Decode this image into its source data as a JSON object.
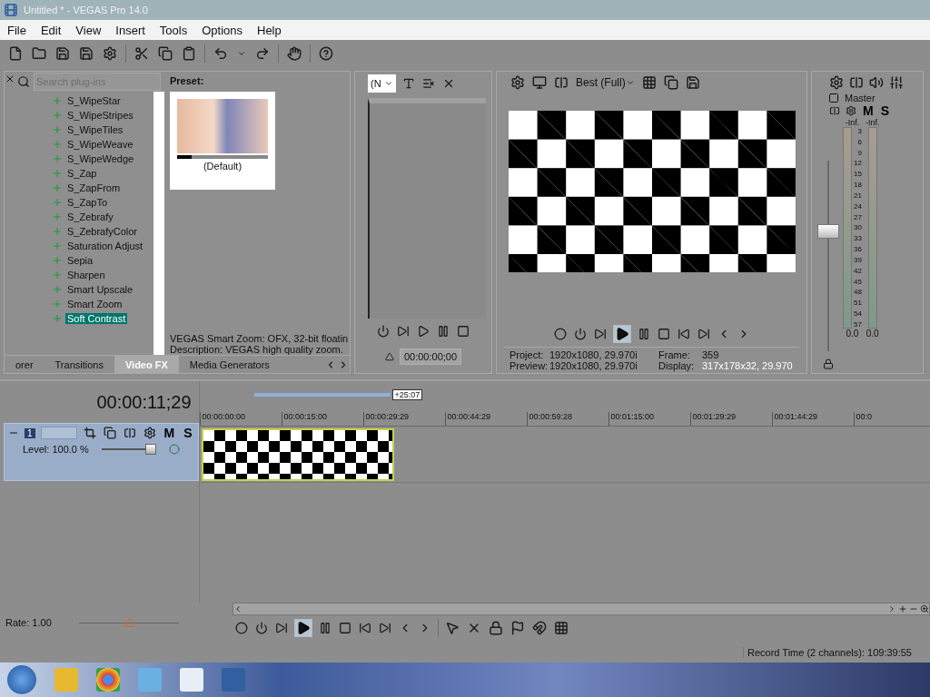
{
  "window": {
    "title": "Untitled * - VEGAS Pro 14.0"
  },
  "menu": [
    "File",
    "Edit",
    "View",
    "Insert",
    "Tools",
    "Options",
    "Help"
  ],
  "explorer": {
    "search": {
      "placeholder": "Search plug-ins"
    },
    "items": [
      {
        "label": "S_WipeStar",
        "selected": false
      },
      {
        "label": "S_WipeStripes",
        "selected": false
      },
      {
        "label": "S_WipeTiles",
        "selected": false
      },
      {
        "label": "S_WipeWeave",
        "selected": false
      },
      {
        "label": "S_WipeWedge",
        "selected": false
      },
      {
        "label": "S_Zap",
        "selected": false
      },
      {
        "label": "S_ZapFrom",
        "selected": false
      },
      {
        "label": "S_ZapTo",
        "selected": false
      },
      {
        "label": "S_Zebrafy",
        "selected": false
      },
      {
        "label": "S_ZebrafyColor",
        "selected": false
      },
      {
        "label": "Saturation Adjust",
        "selected": false
      },
      {
        "label": "Sepia",
        "selected": false
      },
      {
        "label": "Sharpen",
        "selected": false
      },
      {
        "label": "Smart Upscale",
        "selected": false
      },
      {
        "label": "Smart Zoom",
        "selected": false
      },
      {
        "label": "Soft Contrast",
        "selected": true
      }
    ],
    "preset_label": "Preset:",
    "preset_name": "(Default)",
    "preset_progress": {
      "level": 0.16
    },
    "description": [
      "VEGAS Smart Zoom: OFX, 32-bit floatin",
      "Description: VEGAS high quality zoom."
    ],
    "tabs": [
      {
        "label": "orer",
        "selected": false
      },
      {
        "label": "Transitions",
        "selected": false
      },
      {
        "label": "Video FX",
        "selected": true
      },
      {
        "label": "Media Generators",
        "selected": false
      }
    ]
  },
  "trimmer": {
    "dropdown": "(N",
    "timecode": "00:00:00;00"
  },
  "preview": {
    "quality": "Best (Full)",
    "play_active": true,
    "info": [
      {
        "label": "Project:",
        "value": "1920x1080, 29.970i"
      },
      {
        "label": "Frame:",
        "value": "359"
      },
      {
        "label": "Preview:",
        "value": "1920x1080, 29.970i"
      },
      {
        "label": "Display:",
        "value": "317x178x32, 29.970"
      }
    ]
  },
  "mixer": {
    "name": "Master",
    "mute": "M",
    "solo": "S",
    "peaks": [
      "-Inf.",
      "-Inf."
    ],
    "scale": [
      "3",
      "6",
      "9",
      "12",
      "15",
      "18",
      "21",
      "24",
      "27",
      "30",
      "33",
      "36",
      "39",
      "42",
      "45",
      "48",
      "51",
      "54",
      "57"
    ],
    "readings": [
      "0.0",
      "0.0"
    ],
    "fader": {
      "level": 0.64
    }
  },
  "timeline": {
    "timecode": "00:00:11;29",
    "region_length": "+25:07",
    "ruler": [
      "00:00:00:00",
      "00:00:15:00",
      "00:00:29:29",
      "00:00:44:29",
      "00:00:59:28",
      "00:01:15:00",
      "00:01:29:29",
      "00:01:44:29",
      "00:0"
    ],
    "track": {
      "number": "1",
      "mute": "M",
      "solo": "S",
      "level_label": "Level: 100.0 %",
      "level": 1.0
    },
    "rate": "Rate: 1.00",
    "rate_slider": {
      "level": 0.5
    },
    "play_active": true,
    "record_time": "Record Time (2 channels): 109:39:55"
  }
}
